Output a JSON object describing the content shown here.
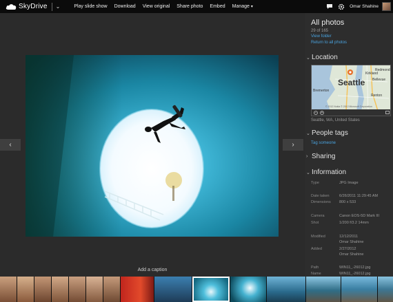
{
  "app": {
    "brand": "SkyDrive",
    "commands": [
      "Play slide show",
      "Download",
      "View original",
      "Share photo",
      "Embed",
      "Manage"
    ],
    "user_name": "Omar Shahine"
  },
  "panel": {
    "title": "All photos",
    "position_text": "29 of 165",
    "view_folder": "View folder",
    "return_link": "Return to all photos",
    "location": {
      "heading": "Location",
      "map_label": "Seattle",
      "map_places": [
        "Bellevue",
        "Redmond",
        "Kirkland",
        "Renton",
        "Bremerton"
      ],
      "map_copyright": "© 2012 Nokia  © 2012 Microsoft Corporation",
      "zoom_out": "−",
      "zoom_in": "+",
      "place": "Seattle, WA, United States"
    },
    "people": {
      "heading": "People tags",
      "link": "Tag someone"
    },
    "sharing": {
      "heading": "Sharing"
    },
    "information": {
      "heading": "Information",
      "type_label": "Type",
      "type_value": "JPG Image",
      "date_taken_label": "Date taken",
      "date_taken_value": "6/26/2011 11:29:45 AM",
      "dimensions_label": "Dimensions",
      "dimensions_value": "800 x 533",
      "camera_label": "Camera",
      "camera_value": "Canon EOS-5D Mark III",
      "shot_label": "Shot",
      "shot_value": "1/200 f/3.2 14mm",
      "modified_label": "Modified",
      "modified_date": "12/12/2011",
      "modified_by": "Omar Shahine",
      "added_label": "Added",
      "added_date": "2/27/2012",
      "added_by": "Omar Shahine",
      "path_label": "Path",
      "path_value": "WIN11_-26012.jpg",
      "name_label": "Name",
      "name_value": "WIN11_-26012.jpg"
    }
  },
  "stage": {
    "caption_placeholder": "Add a caption"
  },
  "colors": {
    "accent": "#4aa3df",
    "topbar": "#0b0b0b",
    "panel": "#2d2d2d"
  }
}
